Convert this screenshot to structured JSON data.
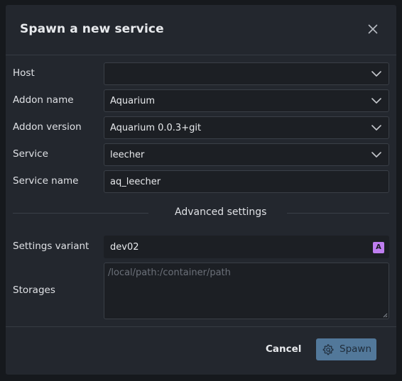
{
  "dialog": {
    "title": "Spawn a new service",
    "close_icon": "close-icon"
  },
  "form": {
    "host": {
      "label": "Host",
      "value": ""
    },
    "addon_name": {
      "label": "Addon name",
      "value": "Aquarium"
    },
    "addon_version": {
      "label": "Addon version",
      "value": "Aquarium 0.0.3+git"
    },
    "service": {
      "label": "Service",
      "value": "leecher"
    },
    "service_name": {
      "label": "Service name",
      "value": "aq_leecher"
    }
  },
  "advanced": {
    "heading": "Advanced settings",
    "settings_variant": {
      "label": "Settings variant",
      "value": "dev02",
      "badge": "A",
      "badge_color": "#bf7ef0"
    },
    "storages": {
      "label": "Storages",
      "value": "",
      "placeholder": "/local/path:/container/path"
    }
  },
  "footer": {
    "cancel_label": "Cancel",
    "spawn_label": "Spawn",
    "spawn_icon": "gear-icon",
    "spawn_color": "#52789a"
  }
}
